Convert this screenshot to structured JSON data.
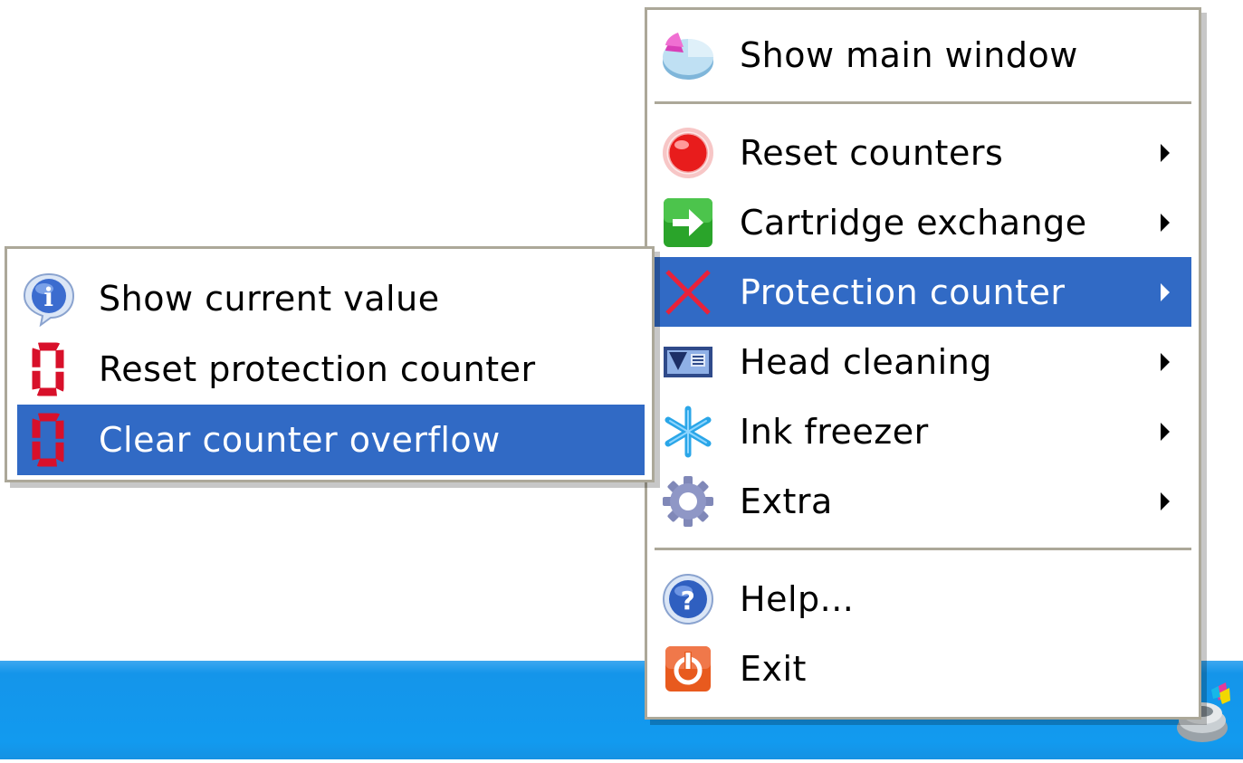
{
  "main_menu": {
    "items": [
      {
        "label": "Show main window",
        "icon": "pie-chart-icon",
        "submenu": false
      },
      {
        "label": "Reset counters",
        "icon": "red-ball-icon",
        "submenu": true
      },
      {
        "label": "Cartridge exchange",
        "icon": "green-arrow-icon",
        "submenu": true
      },
      {
        "label": "Protection counter",
        "icon": "red-x-icon",
        "submenu": true,
        "selected": true
      },
      {
        "label": "Head cleaning",
        "icon": "printer-head-icon",
        "submenu": true
      },
      {
        "label": "Ink freezer",
        "icon": "snowflake-icon",
        "submenu": true
      },
      {
        "label": "Extra",
        "icon": "gear-icon",
        "submenu": true
      },
      {
        "label": "Help...",
        "icon": "help-icon",
        "submenu": false
      },
      {
        "label": "Exit",
        "icon": "power-icon",
        "submenu": false
      }
    ]
  },
  "sub_menu": {
    "items": [
      {
        "label": "Show current value",
        "icon": "info-icon"
      },
      {
        "label": "Reset protection counter",
        "icon": "red-zero-icon"
      },
      {
        "label": "Clear counter overflow",
        "icon": "red-zero-icon",
        "selected": true
      }
    ]
  },
  "colors": {
    "selection": "#316ac5",
    "menu_border": "#aca899",
    "taskbar": "#129aef"
  }
}
